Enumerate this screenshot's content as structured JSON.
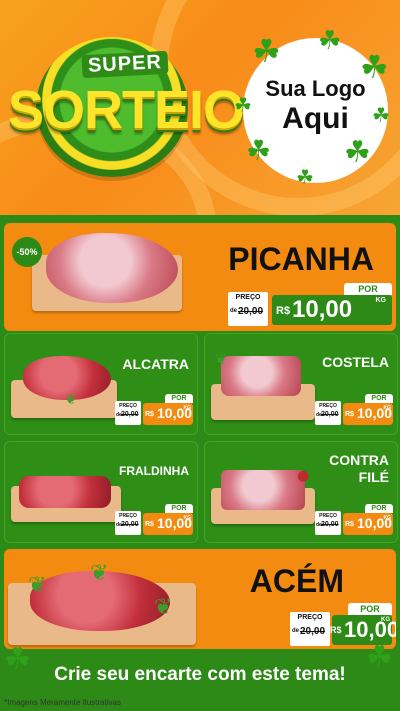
{
  "header": {
    "super_label": "SUPER",
    "sorteio_label": "SORTEIO",
    "logo_line1": "Sua Logo",
    "logo_line2": "Aqui",
    "clover_icon": "clover-icon"
  },
  "products": {
    "picanha": {
      "name": "PICANHA",
      "discount": "-50%",
      "por": "POR",
      "preco": "PREÇO",
      "de": "de",
      "old": "20,00",
      "rs": "R$",
      "value": "10,00",
      "kg": "KG"
    },
    "alcatra": {
      "name": "ALCATRA",
      "por": "POR",
      "preco": "PREÇO",
      "de": "de",
      "old": "20,00",
      "rs": "R$",
      "value": "10,00",
      "kg": "KG"
    },
    "costela": {
      "name": "COSTELA",
      "por": "POR",
      "preco": "PREÇO",
      "de": "de",
      "old": "20,00",
      "rs": "R$",
      "value": "10,00",
      "kg": "KG"
    },
    "fraldinha": {
      "name": "FRALDINHA",
      "por": "POR",
      "preco": "PREÇO",
      "de": "de",
      "old": "20,00",
      "rs": "R$",
      "value": "10,00",
      "kg": "KG"
    },
    "contrafile": {
      "name_line1": "CONTRA",
      "name_line2": "FILÉ",
      "por": "POR",
      "preco": "PREÇO",
      "de": "de",
      "old": "20,00",
      "rs": "R$",
      "value": "10,00",
      "kg": "KG"
    },
    "acem": {
      "name": "ACÉM",
      "por": "POR",
      "preco": "PREÇO",
      "de": "de",
      "old": "20,00",
      "rs": "R$",
      "value": "10,00",
      "kg": "KG"
    }
  },
  "footer": {
    "cta": "Crie seu encarte com este tema!",
    "disclaimer": "*Imagens Meramente Ilustrativas"
  },
  "colors": {
    "orange": "#f48b11",
    "green": "#2d8a16",
    "yellow": "#ffe52a"
  }
}
